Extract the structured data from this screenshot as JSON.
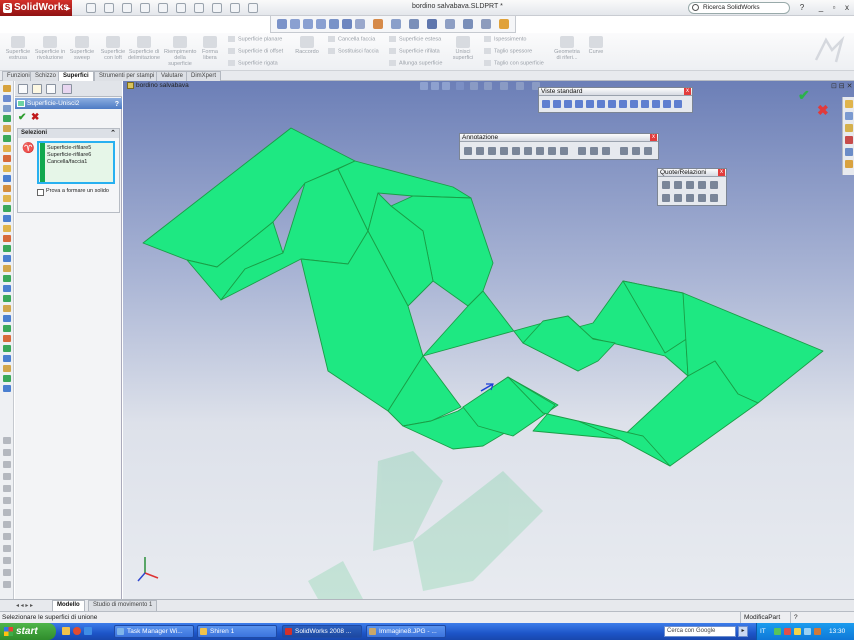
{
  "app": {
    "logo": "SolidWorks",
    "doc_title": "bordino salvabava.SLDPRT *",
    "search_placeholder": "Ricerca SolidWorks",
    "help": "?",
    "minimize": "_",
    "restore": "▫",
    "close": "x"
  },
  "ribbon": {
    "buttons": [
      "Superficie estrusa",
      "Superficie in rivoluzione",
      "Superficie sweep",
      "Superficie con loft",
      "Superficie di delimitazione",
      "Riempimento della superficie",
      "Forma libera",
      "Raccordo",
      "Unisci superfici",
      "Geometria di riferi...",
      "Curve"
    ],
    "col1": [
      "Superficie planare",
      "Superficie di offset",
      "Superficie rigata"
    ],
    "col2": [
      "Cancella faccia",
      "Sostituisci faccia"
    ],
    "col3": [
      "Superficie estesa",
      "Superficie rifilata",
      "Allunga superficie"
    ],
    "col4": [
      "Ispessimento",
      "Taglio spessore",
      "Taglio con superficie"
    ]
  },
  "tabs": [
    "Funzioni",
    "Schizzo",
    "Superfici",
    "Strumenti per stampi",
    "Valutare",
    "DimXpert"
  ],
  "property_manager": {
    "title": "Superficie-Unisci2",
    "help": "?",
    "ok": "✔",
    "cancel": "✖",
    "selections_title": "Selezioni",
    "selections": [
      "Superficie-rifilare5",
      "Superficie-rifilare6",
      "Cancella/faccia1"
    ],
    "checkbox_label": "Prova a formare un solido"
  },
  "graphics": {
    "tree_item": "bordino salvabava",
    "confirm_ok": "✔",
    "confirm_cancel": "✖"
  },
  "palettes": {
    "viste": "Viste standard",
    "annotazione": "Annotazione",
    "quote": "Quote/Relazioni",
    "close": "x"
  },
  "bottom_tabs": [
    "Modello",
    "Studio di movimento 1"
  ],
  "status": {
    "message": "Selezionare le superfici di unione",
    "mode": "ModificaPart",
    "help": "?"
  },
  "taskbar": {
    "start": "start",
    "tasks": [
      "Task Manager Wi...",
      "Shiren 1",
      "SolidWorks 2008 ...",
      "Immagine8.JPG - ..."
    ],
    "search": "Cerca con Google",
    "lang": "IT",
    "time": "13:30"
  },
  "colors": {
    "surface": "#1ee882",
    "surface_edge": "#1a9e46",
    "accent": "#4d7bc4"
  }
}
